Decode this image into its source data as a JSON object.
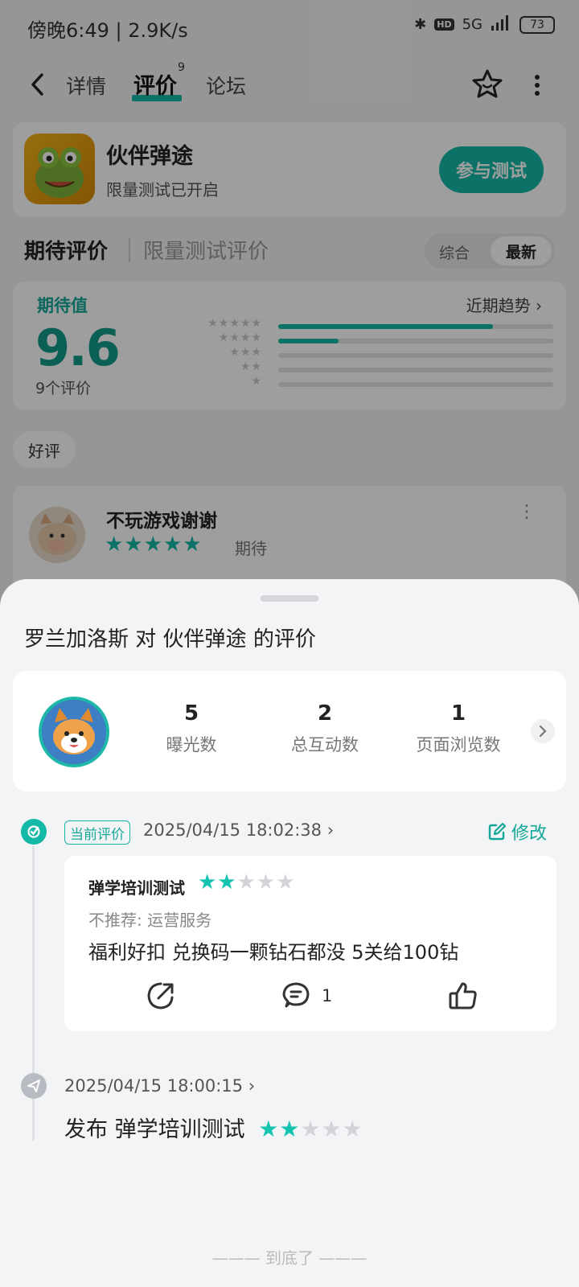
{
  "status_bar": {
    "left": "傍晚6:49 | 2.9K/s",
    "network": "5G",
    "battery": "73"
  },
  "nav": {
    "tab_detail": "详情",
    "tab_review": "评价",
    "review_badge": "9",
    "tab_forum": "论坛"
  },
  "app": {
    "name": "伙伴弹途",
    "subtitle": "限量测试已开启",
    "join_label": "参与测试"
  },
  "rating_tabs": {
    "expect": "期待评价",
    "test": "限量测试评价",
    "sort_all": "综合",
    "sort_new": "最新"
  },
  "score": {
    "label": "期待值",
    "trend": "近期趋势",
    "value": "9.6",
    "count": "9个评价",
    "distribution": [
      0.78,
      0.22,
      0,
      0,
      0
    ]
  },
  "filter_chip": "好评",
  "preview_review": {
    "user": "不玩游戏谢谢",
    "tag": "期待",
    "stars": 5
  },
  "sheet": {
    "user": "罗兰加洛斯",
    "mid": " 对 ",
    "app": "伙伴弹途",
    "suffix": " 的评价",
    "stats": [
      {
        "num": "5",
        "label": "曝光数"
      },
      {
        "num": "2",
        "label": "总互动数"
      },
      {
        "num": "1",
        "label": "页面浏览数"
      }
    ],
    "current": {
      "badge": "当前评价",
      "time": "2025/04/15 18:02:38",
      "edit": "修改",
      "reviewer": "弹学培训测试",
      "stars": 2,
      "reason": "不推荐: 运营服务",
      "content": "福利好扣 兑换码一颗钻石都没 5关给100钻",
      "comment_count": "1"
    },
    "previous": {
      "time": "2025/04/15 18:00:15",
      "prefix": "发布",
      "reviewer": "弹学培训测试",
      "stars": 2
    },
    "end_text": "到底了"
  },
  "colors": {
    "accent": "#14b8a6",
    "dim": "rgba(0,0,0,0.38)"
  }
}
